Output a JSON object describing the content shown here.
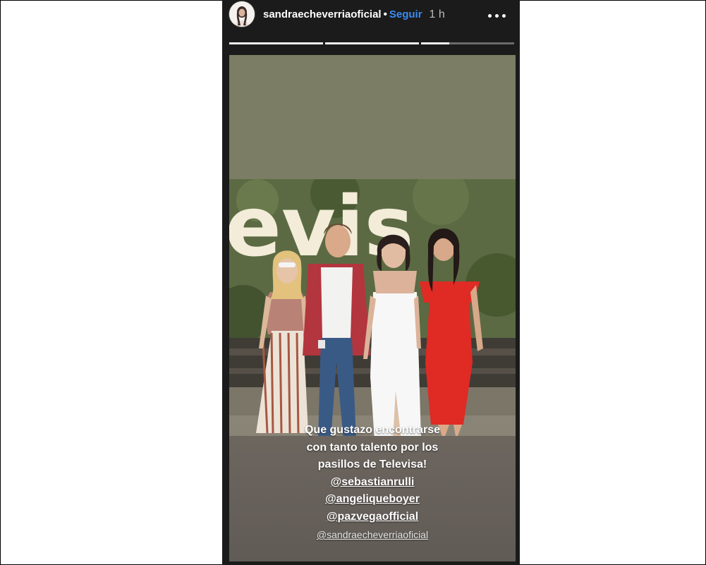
{
  "header": {
    "username": "sandraecheverriaoficial",
    "separator": "•",
    "follow_label": "Seguir",
    "time_ago": "1 h",
    "more_icon": "more-horizontal-icon"
  },
  "progress": {
    "segments": 3,
    "current_segment": 3,
    "current_fill": 0.3
  },
  "photo": {
    "sign_text": "evis"
  },
  "caption": {
    "lines": [
      "Que gustazo encontrarse",
      "con tanto talento por los",
      "pasillos de Televisa!"
    ],
    "mentions": [
      "@sebastianrulli",
      "@angeliqueboyer",
      "@pazvegaofficial"
    ]
  },
  "owner_mention": "@sandraecheverriaoficial",
  "colors": {
    "follow": "#3a8cf1",
    "story_bg": "#1b1b1b",
    "media_top": "#7b7d64"
  }
}
